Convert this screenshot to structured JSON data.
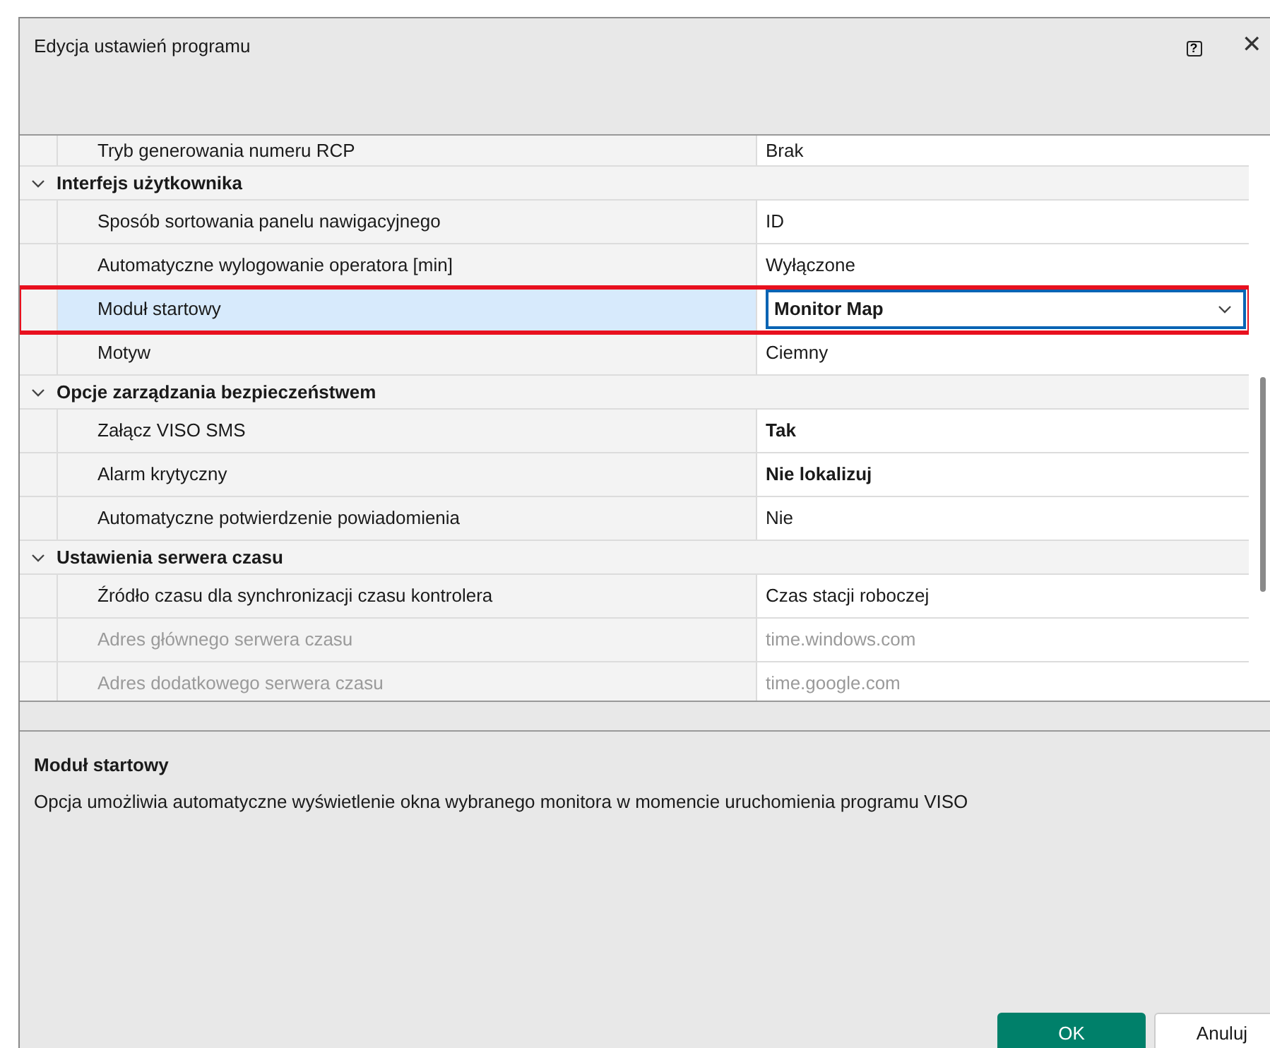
{
  "window": {
    "title": "Edycja ustawień programu",
    "help_glyph": "?",
    "close_glyph": "✕"
  },
  "grid": {
    "rows": [
      {
        "kind": "property",
        "name": "Tryb generowania numeru RCP",
        "value": "Brak",
        "modified": false,
        "disabled": false,
        "selected": false
      },
      {
        "kind": "category",
        "name": "Interfejs użytkownika",
        "expanded": true,
        "children": [
          {
            "kind": "property",
            "name": "Sposób sortowania panelu nawigacyjnego",
            "value": "ID",
            "modified": false,
            "disabled": false,
            "selected": false
          },
          {
            "kind": "property",
            "name": "Automatyczne wylogowanie operatora [min]",
            "value": "Wyłączone",
            "modified": false,
            "disabled": false,
            "selected": false
          },
          {
            "kind": "property",
            "name": "Moduł startowy",
            "value": "Monitor Map",
            "modified": true,
            "disabled": false,
            "selected": true,
            "highlighted": true
          },
          {
            "kind": "property",
            "name": "Motyw",
            "value": "Ciemny",
            "modified": false,
            "disabled": false,
            "selected": false
          }
        ]
      },
      {
        "kind": "category",
        "name": "Opcje zarządzania bezpieczeństwem",
        "expanded": true,
        "children": [
          {
            "kind": "property",
            "name": "Załącz VISO SMS",
            "value": "Tak",
            "modified": true,
            "disabled": false,
            "selected": false
          },
          {
            "kind": "property",
            "name": "Alarm krytyczny",
            "value": "Nie lokalizuj",
            "modified": true,
            "disabled": false,
            "selected": false
          },
          {
            "kind": "property",
            "name": "Automatyczne potwierdzenie powiadomienia",
            "value": "Nie",
            "modified": false,
            "disabled": false,
            "selected": false
          }
        ]
      },
      {
        "kind": "category",
        "name": "Ustawienia serwera czasu",
        "expanded": true,
        "children": [
          {
            "kind": "property",
            "name": "Źródło czasu dla synchronizacji czasu kontrolera",
            "value": "Czas stacji roboczej",
            "modified": false,
            "disabled": false,
            "selected": false
          },
          {
            "kind": "property",
            "name": "Adres głównego serwera czasu",
            "value": "time.windows.com",
            "modified": false,
            "disabled": true,
            "selected": false
          },
          {
            "kind": "property",
            "name": "Adres dodatkowego serwera czasu",
            "value": "time.google.com",
            "modified": false,
            "disabled": true,
            "selected": false
          }
        ]
      }
    ]
  },
  "description": {
    "title": "Moduł startowy",
    "text": "Opcja umożliwia automatyczne wyświetlenie okna wybranego monitora w momencie uruchomienia programu VISO"
  },
  "buttons": [
    {
      "label": "OK",
      "kind": "primary"
    },
    {
      "label": "Anuluj",
      "kind": "secondary"
    }
  ]
}
